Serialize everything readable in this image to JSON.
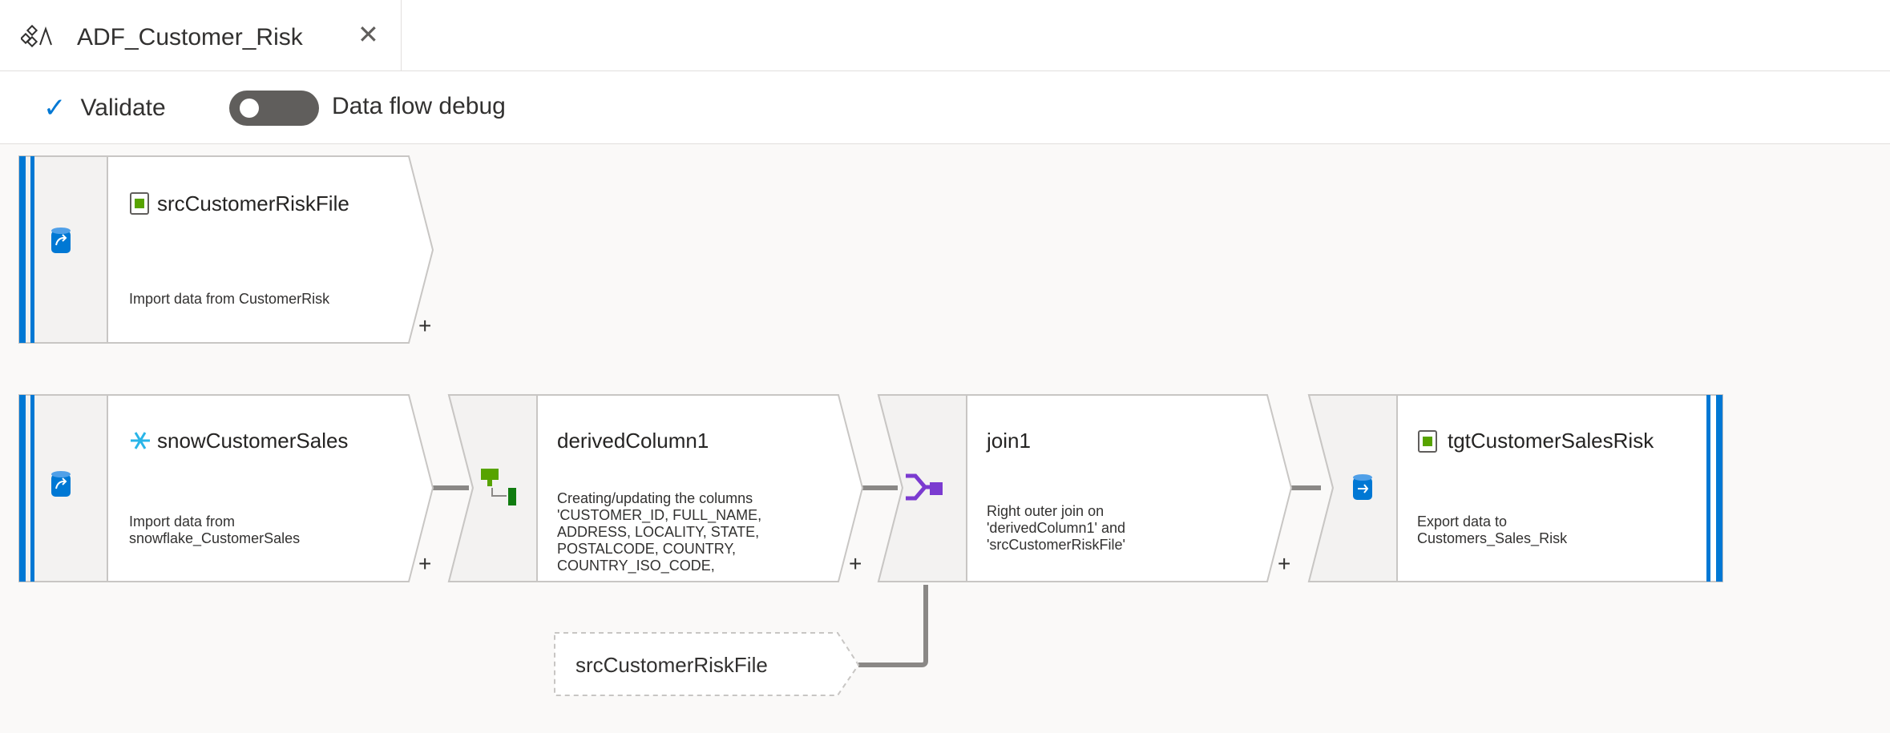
{
  "tab": {
    "title": "ADF_Customer_Risk",
    "icon": "data-flow-icon",
    "close_icon": "close-icon",
    "close_glyph": "✕"
  },
  "toolbar": {
    "validate_label": "Validate",
    "validate_icon": "checkmark-icon",
    "validate_glyph": "✓",
    "debug_label": "Data flow debug",
    "debug_on": false
  },
  "nodes": {
    "src_risk": {
      "title": "srcCustomerRiskFile",
      "title_icon": "file-icon",
      "type_icon": "source-icon",
      "desc_lines": [
        "Import data from CustomerRisk"
      ]
    },
    "snow_sales": {
      "title": "snowCustomerSales",
      "title_icon": "snowflake-icon",
      "type_icon": "source-icon",
      "desc_lines": [
        "Import data from",
        "snowflake_CustomerSales"
      ]
    },
    "derived": {
      "title": "derivedColumn1",
      "type_icon": "derived-column-icon",
      "desc_lines": [
        "Creating/updating the columns",
        "'CUSTOMER_ID, FULL_NAME,",
        "ADDRESS, LOCALITY, STATE,",
        "POSTALCODE, COUNTRY,",
        "COUNTRY_ISO_CODE,"
      ]
    },
    "join": {
      "title": "join1",
      "type_icon": "join-icon",
      "desc_lines": [
        "Right outer join on",
        "'derivedColumn1' and",
        "'srcCustomerRiskFile'"
      ]
    },
    "sink": {
      "title": "tgtCustomerSalesRisk",
      "title_icon": "file-icon",
      "type_icon": "sink-icon",
      "desc_lines": [
        "Export data to",
        "Customers_Sales_Risk"
      ]
    },
    "join_ref": {
      "title": "srcCustomerRiskFile"
    }
  },
  "add_glyph": "+",
  "colors": {
    "accent": "#0078d4",
    "node_border": "#c8c6c4",
    "icon_strip": "#f3f2f1",
    "link": "#8a8886",
    "join_purple": "#7b3bd0",
    "derived_green": "#57a300"
  }
}
